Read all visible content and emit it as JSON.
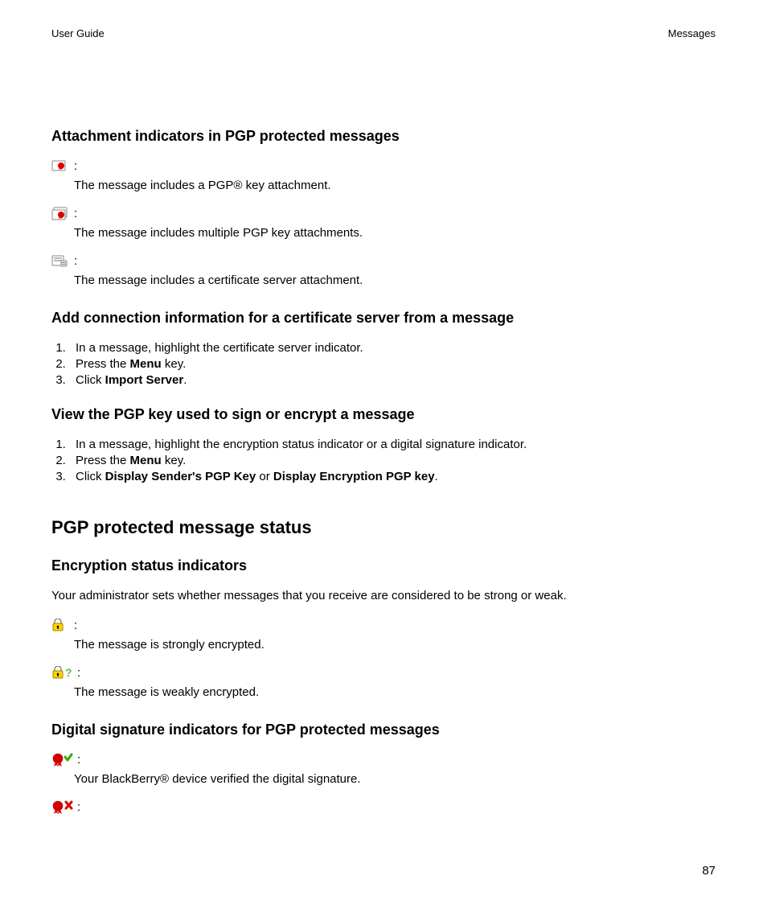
{
  "header": {
    "left": "User Guide",
    "right": "Messages"
  },
  "sec1": {
    "title": "Attachment indicators in PGP protected messages",
    "ind1": "The message includes a PGP® key attachment.",
    "ind2": "The message includes multiple PGP key attachments.",
    "ind3": "The message includes a certificate server attachment."
  },
  "sec2": {
    "title": "Add connection information for a certificate server from a message",
    "s1a": "In a message, highlight the certificate server indicator.",
    "s2a": "Press the ",
    "s2b": "Menu",
    "s2c": " key.",
    "s3a": "Click ",
    "s3b": "Import Server",
    "s3c": "."
  },
  "sec3": {
    "title": "View the PGP key used to sign or encrypt a message",
    "s1a": "In a message, highlight the encryption status indicator or a digital signature indicator.",
    "s2a": "Press the ",
    "s2b": "Menu",
    "s2c": " key.",
    "s3a": "Click ",
    "s3b": "Display Sender's PGP Key",
    "s3c": " or ",
    "s3d": "Display Encryption PGP key",
    "s3e": "."
  },
  "main2": "PGP protected message status",
  "sec4": {
    "title": "Encryption status indicators",
    "intro": "Your administrator sets whether messages that you receive are considered to be strong or weak.",
    "ind1": "The message is strongly encrypted.",
    "ind2": "The message is weakly encrypted."
  },
  "sec5": {
    "title": "Digital signature indicators for PGP protected messages",
    "ind1": "Your BlackBerry® device verified the digital signature."
  },
  "colon": ":",
  "page_number": "87"
}
